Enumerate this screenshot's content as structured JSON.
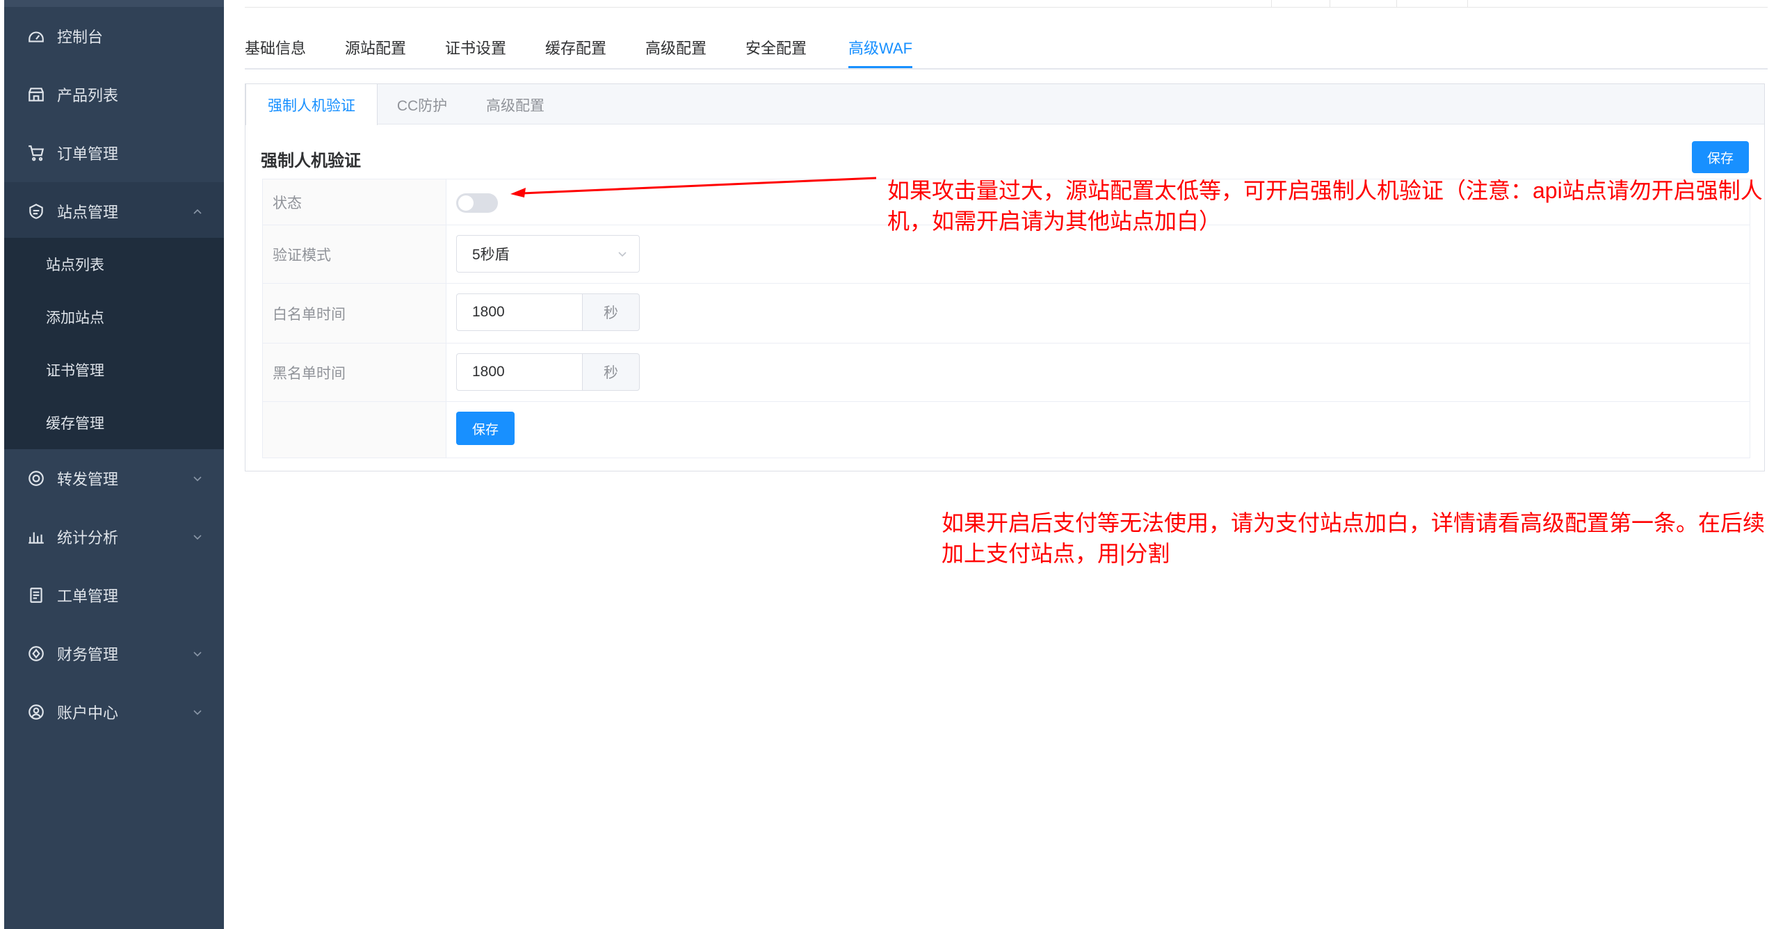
{
  "sidebar": {
    "items": [
      {
        "label": "控制台",
        "icon": "dashboard-icon"
      },
      {
        "label": "产品列表",
        "icon": "store-icon"
      },
      {
        "label": "订单管理",
        "icon": "cart-icon"
      },
      {
        "label": "站点管理",
        "icon": "site-icon",
        "expanded": true
      },
      {
        "label": "转发管理",
        "icon": "forward-icon"
      },
      {
        "label": "统计分析",
        "icon": "chart-icon"
      },
      {
        "label": "工单管理",
        "icon": "ticket-icon"
      },
      {
        "label": "财务管理",
        "icon": "finance-icon"
      },
      {
        "label": "账户中心",
        "icon": "user-icon"
      }
    ],
    "subitems": [
      {
        "label": "站点列表"
      },
      {
        "label": "添加站点"
      },
      {
        "label": "证书管理"
      },
      {
        "label": "缓存管理"
      }
    ]
  },
  "tabs": [
    {
      "label": "基础信息"
    },
    {
      "label": "源站配置"
    },
    {
      "label": "证书设置"
    },
    {
      "label": "缓存配置"
    },
    {
      "label": "高级配置"
    },
    {
      "label": "安全配置"
    },
    {
      "label": "高级WAF",
      "active": true
    }
  ],
  "subtabs": [
    {
      "label": "强制人机验证",
      "active": true
    },
    {
      "label": "CC防护"
    },
    {
      "label": "高级配置"
    }
  ],
  "section": {
    "title": "强制人机验证",
    "save_label": "保存"
  },
  "form": {
    "status_label": "状态",
    "status_on": false,
    "mode_label": "验证模式",
    "mode_value": "5秒盾",
    "whitelist_label": "白名单时间",
    "whitelist_value": "1800",
    "whitelist_unit": "秒",
    "blacklist_label": "黑名单时间",
    "blacklist_value": "1800",
    "blacklist_unit": "秒",
    "submit_label": "保存"
  },
  "annotations": {
    "note1_line1": "如果攻击量过大，源站配置太低等，可开启强制人机验证（注意：api站点请勿开启强制人",
    "note1_line2": "机，如需开启请为其他站点加白）",
    "note2_line1": "如果开启后支付等无法使用，请为支付站点加白，详情请看高级配置第一条。在后续",
    "note2_line2": "加上支付站点，用|分割"
  },
  "colors": {
    "sidebar_bg": "#304156",
    "submenu_bg": "#1f2d3d",
    "accent": "#1890ff",
    "annotation": "#ff0000"
  }
}
